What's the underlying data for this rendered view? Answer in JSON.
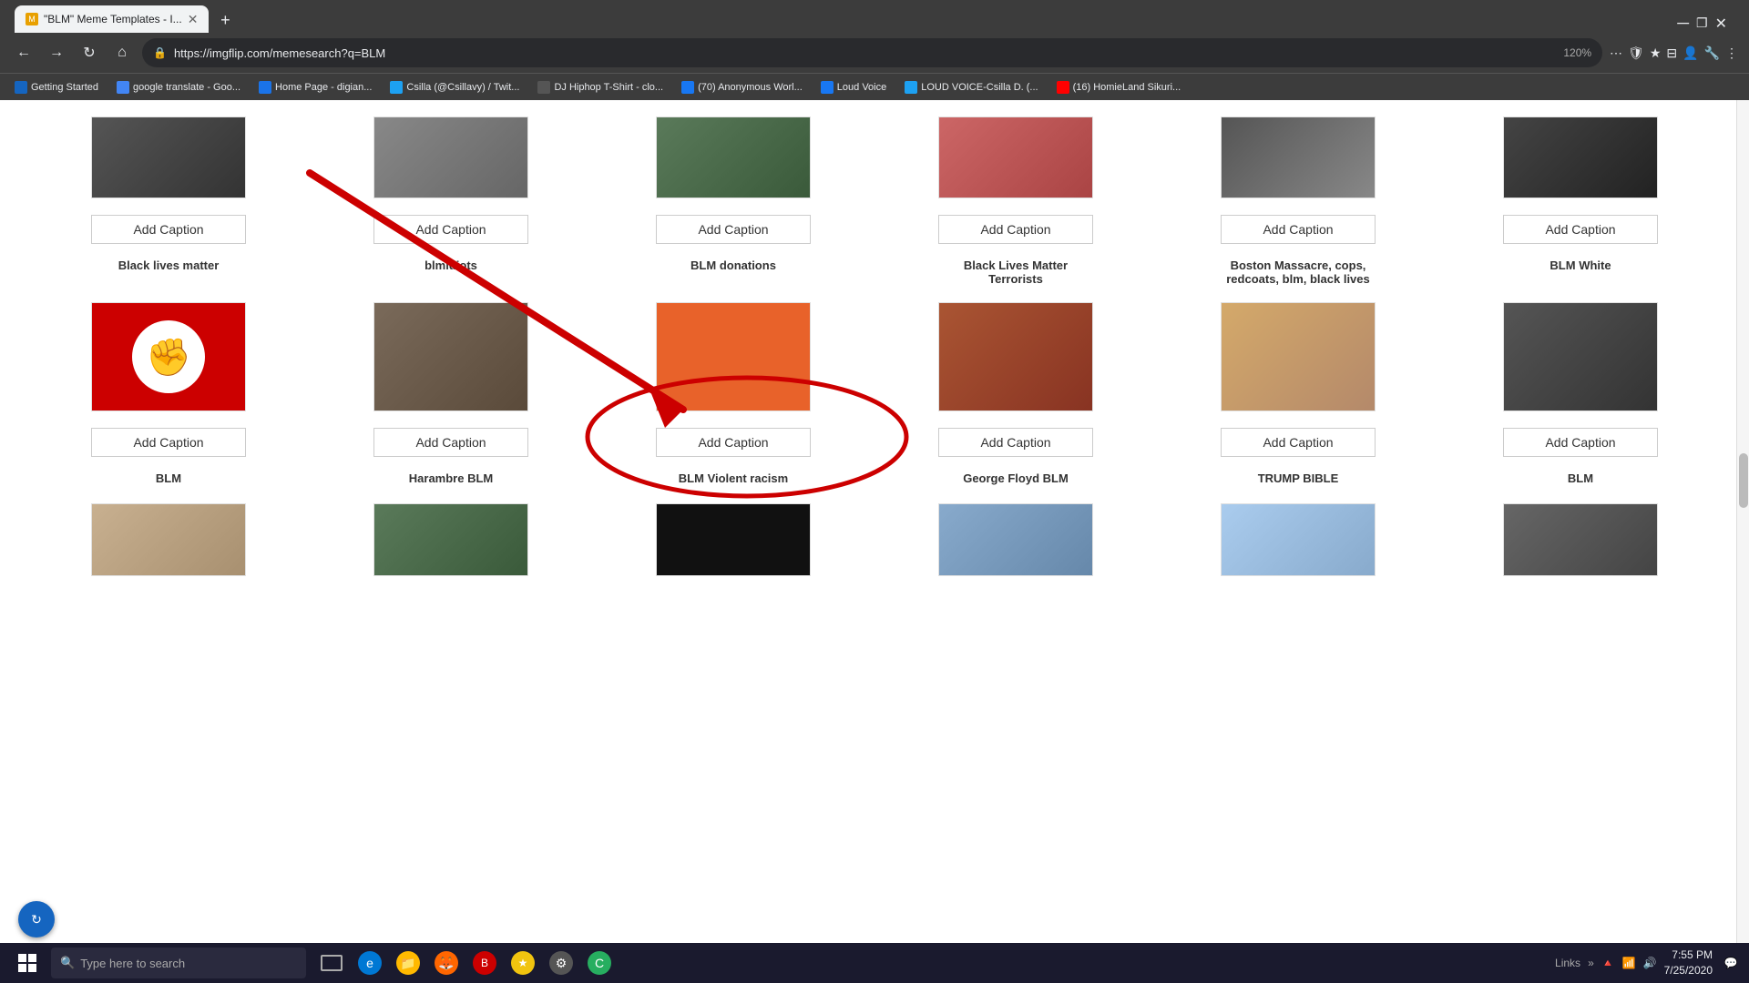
{
  "browser": {
    "title": "\"BLM\" Meme Templates - I...",
    "tab_label": "\"BLM\" Meme Templates - I...",
    "url": "https://imgflip.com/memesearch?q=BLM",
    "zoom": "120%",
    "new_tab_icon": "+"
  },
  "bookmarks": [
    {
      "label": "Getting Started",
      "color": "#1565c0"
    },
    {
      "label": "google translate - Goo...",
      "color": "#4285f4"
    },
    {
      "label": "Home Page - digian...",
      "color": "#1a73e8"
    },
    {
      "label": "Csilla (@Csillavy) / Twit...",
      "color": "#1da1f2"
    },
    {
      "label": "DJ Hiphop T-Shirt - clo...",
      "color": "#555"
    },
    {
      "label": "(70) Anonymous Worl...",
      "color": "#1877f2"
    },
    {
      "label": "Loud Voice",
      "color": "#1877f2"
    },
    {
      "label": "LOUD VOICE-Csilla D. (...",
      "color": "#1da1f2"
    },
    {
      "label": "(16) HomieLand Sikuri...",
      "color": "#ff0000"
    }
  ],
  "add_caption_label": "Add Caption",
  "rows": [
    {
      "items": [
        {
          "title": "Black lives matter",
          "img_class": "img-blm1"
        },
        {
          "title": "blmidiots",
          "img_class": "img-blm2"
        },
        {
          "title": "BLM donations",
          "img_class": "img-gorilla"
        },
        {
          "title": "Black Lives Matter Terrorists",
          "img_class": "img-fire1"
        },
        {
          "title": "Boston Massacre, cops, redcoats, blm, black lives",
          "img_class": "img-protest"
        },
        {
          "title": "BLM White",
          "img_class": "img-dark"
        }
      ]
    },
    {
      "items": [
        {
          "title": "BLM",
          "img_class": "img-fist"
        },
        {
          "title": "Harambre BLM",
          "img_class": "img-starbucks"
        },
        {
          "title": "BLM Violent racism",
          "img_class": "img-orange"
        },
        {
          "title": "George Floyd BLM",
          "img_class": "img-fire2"
        },
        {
          "title": "TRUMP BIBLE",
          "img_class": "img-boston"
        },
        {
          "title": "BLM",
          "img_class": "img-blm-group"
        }
      ]
    },
    {
      "items": [
        {
          "title": "",
          "img_class": "img-hands"
        },
        {
          "title": "",
          "img_class": "img-gorilla2"
        },
        {
          "title": "",
          "img_class": "img-black"
        },
        {
          "title": "",
          "img_class": "img-floyd"
        },
        {
          "title": "",
          "img_class": "img-trump"
        },
        {
          "title": "",
          "img_class": "img-cars"
        }
      ]
    }
  ],
  "taskbar": {
    "search_placeholder": "Type here to search",
    "time": "7:55 PM",
    "date": "7/25/2020",
    "links_label": "Links"
  }
}
